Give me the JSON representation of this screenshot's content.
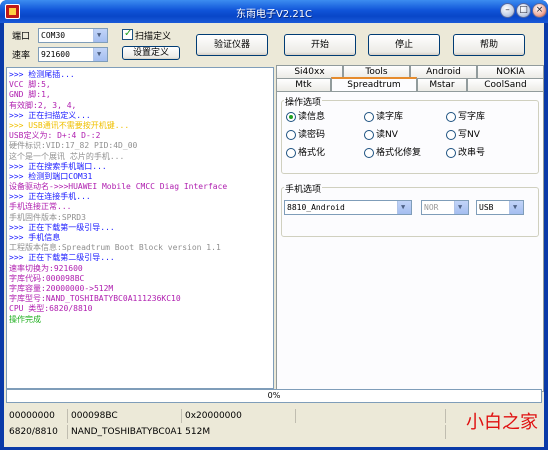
{
  "window": {
    "title": "东雨电子V2.21C",
    "controls": {
      "minimize": "–",
      "maximize": "□",
      "close": "×"
    }
  },
  "config": {
    "port_label": "端口",
    "port_value": "COM30",
    "baud_label": "速率",
    "baud_value": "921600",
    "scan_define_label": "扫描定义",
    "scan_define_checked": true,
    "set_define_label": "设置定义"
  },
  "toolbar": {
    "verify_label": "验证仪器",
    "start_label": "开始",
    "stop_label": "停止",
    "help_label": "帮助"
  },
  "log": [
    {
      "text": ">>> 检测尾插...",
      "color": "#1a1aff"
    },
    {
      "text": "    VCC 脚:5,",
      "color": "#b020b0"
    },
    {
      "text": "    GND 脚:1,",
      "color": "#b020b0"
    },
    {
      "text": "    有效脚:2, 3, 4,",
      "color": "#b020b0"
    },
    {
      "text": ">>> 正在扫描定义...",
      "color": "#1a1aff"
    },
    {
      "text": ">>> USB通讯不需要按开机键...",
      "color": "#f0c000"
    },
    {
      "text": "    USB定义为: D+:4  D-:2",
      "color": "#b020b0"
    },
    {
      "text": "    硬件标识:VID:17_82 PID:4D_00",
      "color": "#909090"
    },
    {
      "text": "    这个是一个展讯 芯片的手机...",
      "color": "#909090"
    },
    {
      "text": ">>> 正在搜索手机端口...",
      "color": "#1a1aff"
    },
    {
      "text": ">>> 检测到端口COM31",
      "color": "#1a1aff"
    },
    {
      "text": "    设备驱动名->>>HUAWEI Mobile CMCC Diag Interface",
      "color": "#b020b0"
    },
    {
      "text": ">>> 正在连接手机...",
      "color": "#1a1aff"
    },
    {
      "text": "    手机连接正常...",
      "color": "#b020b0"
    },
    {
      "text": "    手机固件版本:SPRD3",
      "color": "#909090"
    },
    {
      "text": ">>> 正在下载第一级引导...",
      "color": "#1a1aff"
    },
    {
      "text": ">>> 手机信息",
      "color": "#1a1aff"
    },
    {
      "text": "    工程版本信息:Spreadtrum Boot Block version 1.1",
      "color": "#909090"
    },
    {
      "text": ">>> 正在下载第二级引导...",
      "color": "#1a1aff"
    },
    {
      "text": "    速率切换为:921600",
      "color": "#b020b0"
    },
    {
      "text": "    字库代码:000098BC",
      "color": "#b020b0"
    },
    {
      "text": "    字库容量:20000000->512M",
      "color": "#b020b0"
    },
    {
      "text": "    字库型号:NAND_TOSHIBATYBC0A111236KC10",
      "color": "#b020b0"
    },
    {
      "text": "    CPU 类型:6820/8810",
      "color": "#b020b0"
    },
    {
      "text": "    操作完成",
      "color": "#20b020"
    }
  ],
  "tabs_row1": [
    "Si40xx",
    "Tools",
    "Android",
    "NOKIA"
  ],
  "tabs_row2": [
    "Mtk",
    "Spreadtrum",
    "Mstar",
    "CoolSand"
  ],
  "active_tab": "Spreadtrum",
  "operation": {
    "title": "操作选项",
    "options": [
      {
        "label": "读信息",
        "selected": true
      },
      {
        "label": "读字库",
        "selected": false
      },
      {
        "label": "写字库",
        "selected": false
      },
      {
        "label": "读密码",
        "selected": false
      },
      {
        "label": "读NV",
        "selected": false
      },
      {
        "label": "写NV",
        "selected": false
      },
      {
        "label": "格式化",
        "selected": false
      },
      {
        "label": "格式化修复",
        "selected": false
      },
      {
        "label": "改串号",
        "selected": false
      }
    ]
  },
  "phone": {
    "title": "手机选项",
    "model": "8810_Android",
    "flash_type": "NOR",
    "connection": "USB"
  },
  "progress": {
    "value": 0,
    "label": "0%"
  },
  "status": {
    "row1": [
      "00000000",
      "000098BC",
      "0x20000000",
      ""
    ],
    "row2": [
      "6820/8810",
      "NAND_TOSHIBATYBC0A1 512M"
    ]
  },
  "watermark": "小白之家"
}
